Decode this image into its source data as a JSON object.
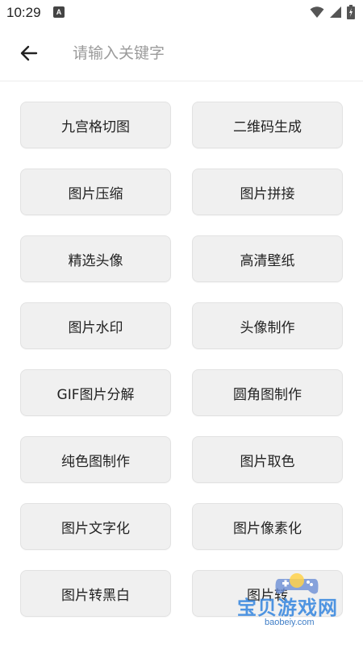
{
  "status_bar": {
    "time": "10:29",
    "app_icon_letter": "A",
    "icons": [
      "wifi-icon",
      "signal-icon",
      "battery-icon"
    ]
  },
  "header": {
    "back_icon": "arrow-left-icon",
    "search_placeholder": "请输入关键字",
    "search_value": ""
  },
  "tools": [
    {
      "label": "九宫格切图"
    },
    {
      "label": "二维码生成"
    },
    {
      "label": "图片压缩"
    },
    {
      "label": "图片拼接"
    },
    {
      "label": "精选头像"
    },
    {
      "label": "高清壁纸"
    },
    {
      "label": "图片水印"
    },
    {
      "label": "头像制作"
    },
    {
      "label": "GIF图片分解"
    },
    {
      "label": "圆角图制作"
    },
    {
      "label": "纯色图制作"
    },
    {
      "label": "图片取色"
    },
    {
      "label": "图片文字化"
    },
    {
      "label": "图片像素化"
    },
    {
      "label": "图片转黑白"
    },
    {
      "label": "图片转"
    }
  ],
  "watermark": {
    "main": "宝贝游戏网",
    "sub": "baobeiy.com"
  },
  "colors": {
    "button_bg": "#f0f0f0",
    "text": "#222222",
    "placeholder": "#9a9a9a",
    "watermark": "#3d8be0"
  }
}
